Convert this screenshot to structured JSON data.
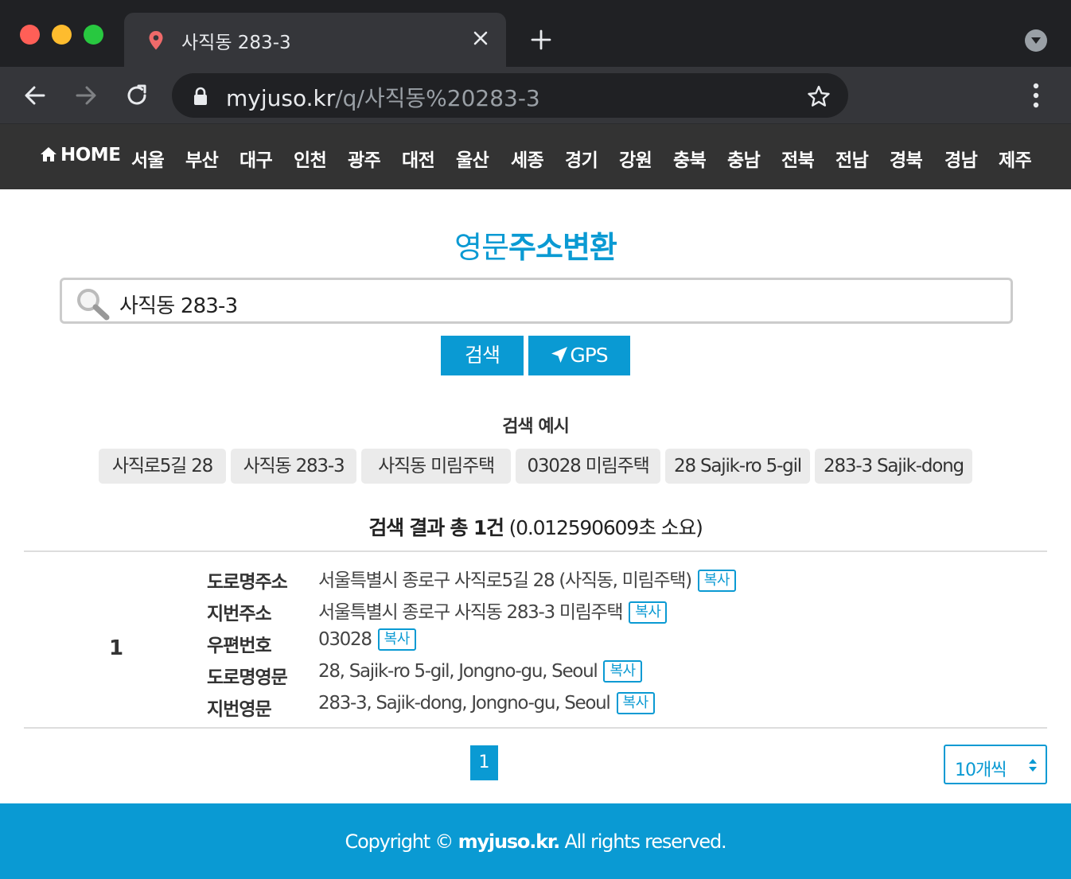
{
  "browser": {
    "tab_title": "사직동 283-3",
    "url_host": "myjuso.kr",
    "url_path": "/q/사직동%20283-3"
  },
  "nav": {
    "home": "HOME",
    "regions": [
      "서울",
      "부산",
      "대구",
      "인천",
      "광주",
      "대전",
      "울산",
      "세종",
      "경기",
      "강원",
      "충북",
      "충남",
      "전북",
      "전남",
      "경북",
      "경남",
      "제주"
    ]
  },
  "page": {
    "title_light": "영문",
    "title_strong": "주소변환"
  },
  "search": {
    "value": "사직동 283-3",
    "search_button": "검색",
    "gps_button": "GPS"
  },
  "examples": {
    "title": "검색 예시",
    "items": [
      "사직로5길 28",
      "사직동 283-3",
      "사직동 미림주택",
      "03028 미림주택",
      "28 Sajik-ro 5-gil",
      "283-3 Sajik-dong"
    ]
  },
  "results": {
    "summary_strong": "검색 결과 총 1건",
    "summary_time": "(0.012590609초 소요)",
    "rows": [
      {
        "number": "1",
        "fields": [
          {
            "label": "도로명주소",
            "value": "서울특별시 종로구 사직로5길 28 (사직동, 미림주택)"
          },
          {
            "label": "지번주소",
            "value": "서울특별시 종로구 사직동 283-3 미림주택"
          },
          {
            "label": "우편번호",
            "value": "03028"
          },
          {
            "label": "도로명영문",
            "value": "28, Sajik-ro 5-gil, Jongno-gu, Seoul"
          },
          {
            "label": "지번영문",
            "value": "283-3, Sajik-dong, Jongno-gu, Seoul"
          }
        ]
      }
    ],
    "copy_label": "복사"
  },
  "pagination": {
    "current_page": "1",
    "per_page": "10개씩"
  },
  "footer": {
    "prefix": "Copyright ©",
    "brand": "myjuso.kr.",
    "suffix": "All rights reserved."
  },
  "colors": {
    "accent": "#0a9ad3",
    "nav_bg": "#333333",
    "chrome_dark": "#202124",
    "chrome_tab": "#35363a"
  }
}
